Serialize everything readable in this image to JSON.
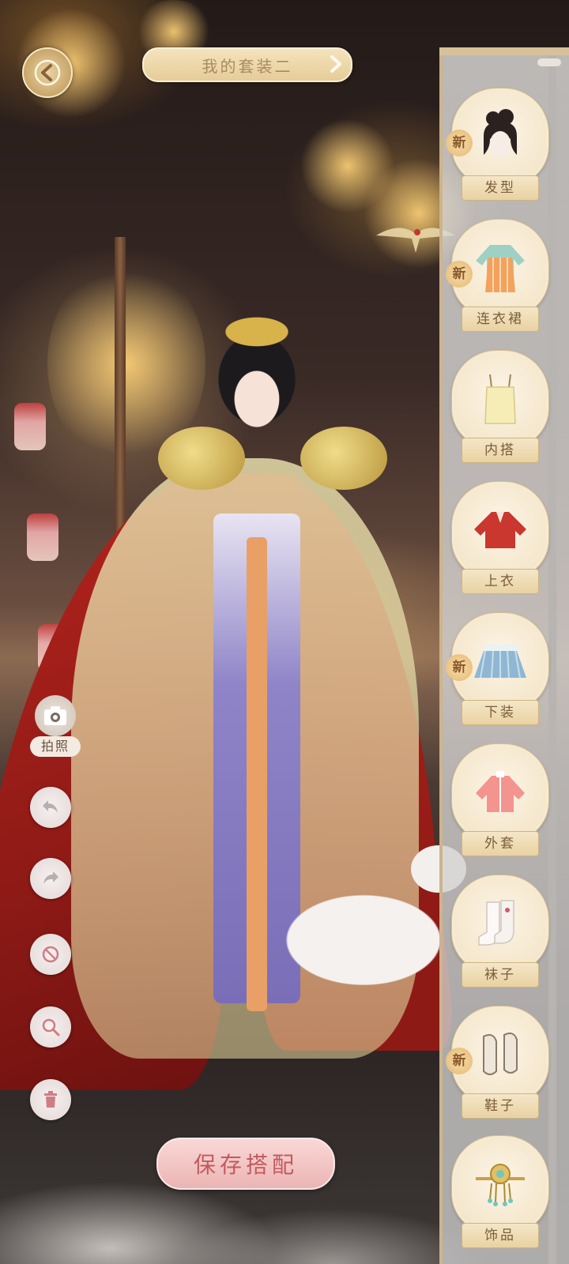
{
  "header": {
    "outfit_title": "我的套装二",
    "back_icon": "back-arrow-icon",
    "title_arrow_icon": "chevron-right-icon"
  },
  "categories": [
    {
      "label": "发型",
      "is_new": true,
      "new_label": "新",
      "icon": "hair-icon"
    },
    {
      "label": "连衣裙",
      "is_new": true,
      "new_label": "新",
      "icon": "dress-icon"
    },
    {
      "label": "内搭",
      "is_new": false,
      "new_label": "",
      "icon": "inner-top-icon"
    },
    {
      "label": "上衣",
      "is_new": false,
      "new_label": "",
      "icon": "top-icon"
    },
    {
      "label": "下装",
      "is_new": true,
      "new_label": "新",
      "icon": "skirt-icon"
    },
    {
      "label": "外套",
      "is_new": false,
      "new_label": "",
      "icon": "coat-icon"
    },
    {
      "label": "袜子",
      "is_new": false,
      "new_label": "",
      "icon": "socks-icon"
    },
    {
      "label": "鞋子",
      "is_new": true,
      "new_label": "新",
      "icon": "shoes-icon"
    },
    {
      "label": "饰品",
      "is_new": false,
      "new_label": "",
      "icon": "accessory-icon"
    }
  ],
  "tools": {
    "photo_label": "拍照",
    "photo_icon": "camera-icon",
    "undo_icon": "undo-icon",
    "redo_icon": "redo-icon",
    "reset_icon": "prohibit-icon",
    "zoom_icon": "magnifier-icon",
    "delete_icon": "trash-icon"
  },
  "footer": {
    "save_label": "保存搭配"
  },
  "colors": {
    "accent_gold": "#e6cd98",
    "save_pink": "#ecb4b4",
    "save_text": "#c25a5e",
    "label_brown": "#7b5d3a"
  }
}
